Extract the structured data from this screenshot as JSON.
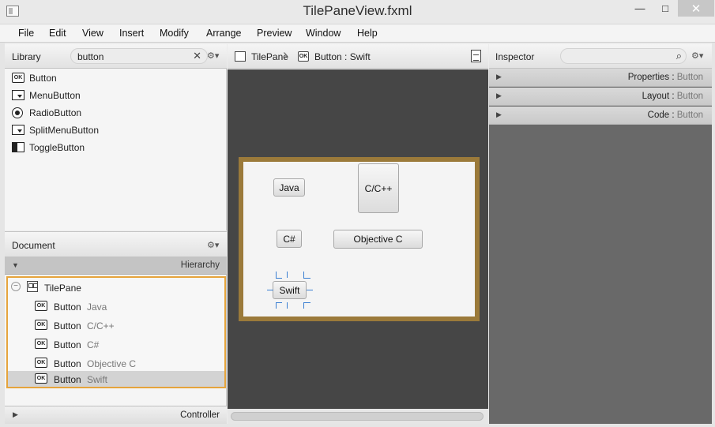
{
  "window": {
    "title": "TilePaneView.fxml",
    "minimize": "—",
    "maximize": "□",
    "close": "✕"
  },
  "menu": [
    "File",
    "Edit",
    "View",
    "Insert",
    "Modify",
    "Arrange",
    "Preview",
    "Window",
    "Help"
  ],
  "library": {
    "label": "Library",
    "search_value": "button",
    "items": [
      {
        "label": "Button",
        "icon": "ok-button-icon"
      },
      {
        "label": "MenuButton",
        "icon": "menu-button-icon"
      },
      {
        "label": "RadioButton",
        "icon": "radio-button-icon"
      },
      {
        "label": "SplitMenuButton",
        "icon": "split-menu-button-icon"
      },
      {
        "label": "ToggleButton",
        "icon": "toggle-button-icon"
      }
    ]
  },
  "document": {
    "label": "Document",
    "hierarchy_label": "Hierarchy",
    "controller_label": "Controller",
    "tree": {
      "root": "TilePane",
      "children": [
        {
          "type": "Button",
          "text": "Java"
        },
        {
          "type": "Button",
          "text": "C/C++"
        },
        {
          "type": "Button",
          "text": "C#"
        },
        {
          "type": "Button",
          "text": "Objective C"
        },
        {
          "type": "Button",
          "text": "Swift",
          "selected": true
        }
      ]
    }
  },
  "breadcrumb": {
    "parent": "TilePane",
    "current": "Button : Swift"
  },
  "canvas": {
    "buttons": [
      "Java",
      "C/C++",
      "C#",
      "Objective C",
      "Swift"
    ]
  },
  "inspector": {
    "label": "Inspector",
    "search_value": "",
    "sections": [
      {
        "name": "Properties",
        "target": "Button"
      },
      {
        "name": "Layout",
        "target": "Button"
      },
      {
        "name": "Code",
        "target": "Button"
      }
    ]
  },
  "icons": {
    "gear": "⚙▾",
    "ok": "OK",
    "clear": "✕",
    "search": "⌕",
    "collapse": "−",
    "triangle_down": "▼",
    "triangle_right": "▶"
  },
  "colors": {
    "selection_outline": "#e6a43c",
    "tilepane_border": "#9b7a3a",
    "handle": "#3a7fd2",
    "canvas_bg": "#464646",
    "inspector_bg": "#696969"
  }
}
